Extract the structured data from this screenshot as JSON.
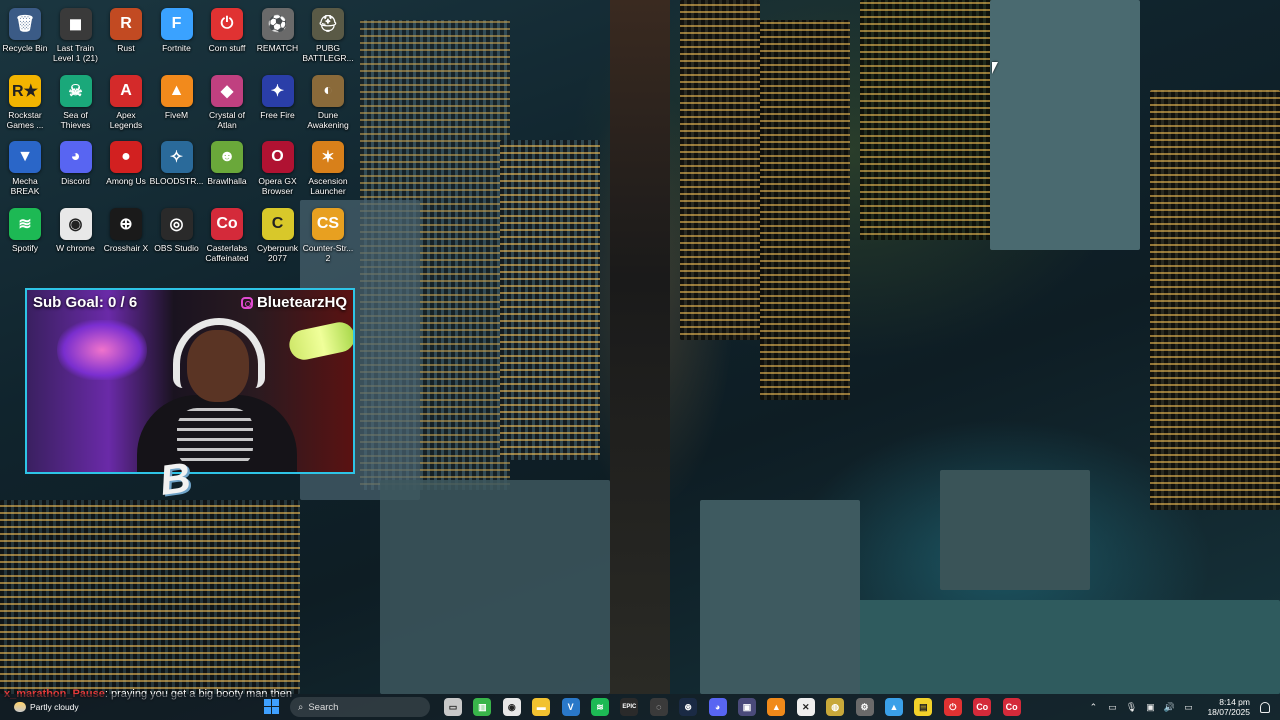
{
  "desktop": {
    "icons": [
      {
        "label": "Recycle Bin",
        "glyph": "🗑",
        "bg": "#3b5b86",
        "icon": "recycle-bin-icon"
      },
      {
        "label": "Last Train\nLevel 1 (21)",
        "glyph": "◼",
        "bg": "#3a3a3a",
        "icon": "game-icon"
      },
      {
        "label": "Rust",
        "glyph": "R",
        "bg": "#c24a22",
        "icon": "rust-icon"
      },
      {
        "label": "Fortnite",
        "glyph": "F",
        "bg": "#3aa2ff",
        "icon": "fortnite-icon"
      },
      {
        "label": "Corn stuff",
        "glyph": "⏻",
        "bg": "#e03232",
        "icon": "corn-stuff-icon"
      },
      {
        "label": "REMATCH",
        "glyph": "⚽",
        "bg": "#6a6a6a",
        "icon": "rematch-icon"
      },
      {
        "label": "PUBG\nBATTLEGR...",
        "glyph": "⛑",
        "bg": "#5a5a46",
        "icon": "pubg-icon"
      },
      {
        "label": "Rockstar\nGames ...",
        "glyph": "R★",
        "bg": "#f2b400",
        "icon": "rockstar-games-icon"
      },
      {
        "label": "Sea of\nThieves",
        "glyph": "☠",
        "bg": "#1aa87a",
        "icon": "sea-of-thieves-icon"
      },
      {
        "label": "Apex\nLegends",
        "glyph": "A",
        "bg": "#d42a2a",
        "icon": "apex-legends-icon"
      },
      {
        "label": "FiveM",
        "glyph": "▲",
        "bg": "#f28a1c",
        "icon": "fivem-icon"
      },
      {
        "label": "Crystal of\nAtlan",
        "glyph": "◆",
        "bg": "#c04080",
        "icon": "crystal-of-atlan-icon"
      },
      {
        "label": "Free Fire",
        "glyph": "✦",
        "bg": "#2a3ea8",
        "icon": "free-fire-icon"
      },
      {
        "label": "Dune\nAwakening",
        "glyph": "◐",
        "bg": "#8a6a3a",
        "icon": "dune-awakening-icon"
      },
      {
        "label": "Mecha\nBREAK",
        "glyph": "▼",
        "bg": "#2a66c8",
        "icon": "mecha-break-icon"
      },
      {
        "label": "Discord",
        "glyph": "◕",
        "bg": "#5865f2",
        "icon": "discord-icon"
      },
      {
        "label": "Among Us",
        "glyph": "●",
        "bg": "#d22020",
        "icon": "among-us-icon"
      },
      {
        "label": "BLOODSTR...",
        "glyph": "✧",
        "bg": "#2a6a9a",
        "icon": "bloodstrike-icon"
      },
      {
        "label": "Brawlhalla",
        "glyph": "☻",
        "bg": "#6aa83a",
        "icon": "brawlhalla-icon"
      },
      {
        "label": "Opera GX\nBrowser",
        "glyph": "O",
        "bg": "#b01232",
        "icon": "opera-gx-icon"
      },
      {
        "label": "Ascension\nLauncher",
        "glyph": "✶",
        "bg": "#d8801a",
        "icon": "ascension-launcher-icon"
      },
      {
        "label": "Spotify",
        "glyph": "≋",
        "bg": "#1db954",
        "icon": "spotify-icon"
      },
      {
        "label": "W chrome",
        "glyph": "◉",
        "bg": "#e8e8e8",
        "icon": "chrome-icon"
      },
      {
        "label": "Crosshair X",
        "glyph": "⊕",
        "bg": "#1a1a1a",
        "icon": "crosshair-x-icon"
      },
      {
        "label": "OBS Studio",
        "glyph": "◎",
        "bg": "#2a2a2a",
        "icon": "obs-studio-icon"
      },
      {
        "label": "Casterlabs\nCaffeinated",
        "glyph": "Co",
        "bg": "#d42a3a",
        "icon": "casterlabs-icon"
      },
      {
        "label": "Cyberpunk\n2077",
        "glyph": "C",
        "bg": "#d8c82a",
        "icon": "cyberpunk-icon"
      },
      {
        "label": "Counter-Str...\n2",
        "glyph": "CS",
        "bg": "#e8a020",
        "icon": "counter-strike-icon"
      }
    ]
  },
  "overlay": {
    "sub_goal": "Sub Goal:  0 / 6",
    "handle": "BluetearzHQ",
    "logo": "B"
  },
  "chat": {
    "username": "x_marathon_Pause",
    "message": ": praying you get a big booty man then"
  },
  "taskbar": {
    "weather": "Partly cloudy",
    "search_placeholder": "Search",
    "apps": [
      {
        "icon": "file-icon",
        "glyph": "▭",
        "bg": "#c8c8c8"
      },
      {
        "icon": "xbox-icon",
        "glyph": "▥",
        "bg": "#39b54a"
      },
      {
        "icon": "chrome-icon",
        "glyph": "◉",
        "bg": "#e8e8e8"
      },
      {
        "icon": "file-explorer-icon",
        "glyph": "▬",
        "bg": "#f2c230"
      },
      {
        "icon": "vscode-icon",
        "glyph": "V",
        "bg": "#2a78c8"
      },
      {
        "icon": "spotify-icon",
        "glyph": "≋",
        "bg": "#1db954"
      },
      {
        "icon": "epic-games-icon",
        "glyph": "EPIC",
        "bg": "#2a2a2a"
      },
      {
        "icon": "ea-icon",
        "glyph": "◌",
        "bg": "#3a3a3a"
      },
      {
        "icon": "steam-icon",
        "glyph": "⊛",
        "bg": "#1a2a44"
      },
      {
        "icon": "discord-icon",
        "glyph": "◕",
        "bg": "#5865f2"
      },
      {
        "icon": "photos-icon",
        "glyph": "▣",
        "bg": "#4a4a7a"
      },
      {
        "icon": "vlc-icon",
        "glyph": "▲",
        "bg": "#f08a1a"
      },
      {
        "icon": "capcut-icon",
        "glyph": "✕",
        "bg": "#eeeeee"
      },
      {
        "icon": "overwolf-icon",
        "glyph": "◍",
        "bg": "#c8a83a"
      },
      {
        "icon": "settings-icon",
        "glyph": "⚙",
        "bg": "#6a6a6a"
      },
      {
        "icon": "photos-app-icon",
        "glyph": "▲",
        "bg": "#3aa0e8"
      },
      {
        "icon": "sticky-notes-icon",
        "glyph": "▤",
        "bg": "#f2d22a"
      },
      {
        "icon": "power-icon",
        "glyph": "⏻",
        "bg": "#e03232"
      },
      {
        "icon": "casterlabs-icon",
        "glyph": "Co",
        "bg": "#d42a3a"
      },
      {
        "icon": "casterlabs-active-icon",
        "glyph": "Co",
        "bg": "#d42a3a"
      }
    ],
    "time": "8:14 pm",
    "date": "18/07/2025"
  }
}
